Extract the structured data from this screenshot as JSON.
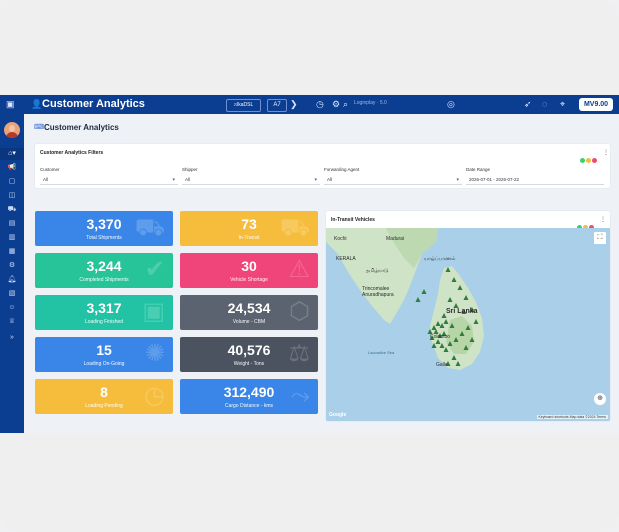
{
  "header": {
    "title": "Customer Analytics",
    "logo_text": "ෆlkaDSL",
    "language": "A7",
    "center_text": "Loginplay · 5.0",
    "right_button": "MV9.00"
  },
  "sidebar": {
    "icons": [
      "home-icon",
      "megaphone-icon",
      "box-icon",
      "package-icon",
      "truck-icon",
      "archive-icon",
      "building-icon",
      "document-icon",
      "gear-icon",
      "bell-icon",
      "calendar-icon",
      "user-icon",
      "trophy-icon",
      "expand-icon"
    ]
  },
  "page": {
    "title": "Customer Analytics"
  },
  "filters": {
    "title": "Customer Analytics Filters",
    "fields": [
      {
        "label": "Customer",
        "value": "All"
      },
      {
        "label": "Shipper",
        "value": "All"
      },
      {
        "label": "Forwarding Agent",
        "value": "All"
      },
      {
        "label": "Date Range",
        "value": "2026-07-01 - 2026-07-22"
      }
    ]
  },
  "tiles": [
    {
      "value": "3,370",
      "label": "Total Shipments",
      "color": "#3a86e8",
      "icon": "truck-icon"
    },
    {
      "value": "73",
      "label": "In-Transit",
      "color": "#f6bd3c",
      "icon": "truck-icon"
    },
    {
      "value": "3,244",
      "label": "Completed Shipments",
      "color": "#27c49a",
      "icon": "check-icon"
    },
    {
      "value": "30",
      "label": "Vehicle Shortage",
      "color": "#f0457a",
      "icon": "warning-icon"
    },
    {
      "value": "3,317",
      "label": "Loading Finished",
      "color": "#21c3a4",
      "icon": "box-icon"
    },
    {
      "value": "24,534",
      "label": "Volume - CBM",
      "color": "#5b6370",
      "icon": "cube-icon"
    },
    {
      "value": "15",
      "label": "Loading On-Going",
      "color": "#3a86e8",
      "icon": "spinner-icon"
    },
    {
      "value": "40,576",
      "label": "Weight - Tons",
      "color": "#4b5260",
      "icon": "weight-icon"
    },
    {
      "value": "8",
      "label": "Loading Pending",
      "color": "#f6bd3c",
      "icon": "clock-icon"
    },
    {
      "value": "312,490",
      "label": "Cargo Distance - kms",
      "color": "#3a86e8",
      "icon": "route-icon"
    }
  ],
  "map": {
    "title": "In-Transit Vehicles",
    "labels": {
      "kochi": "Kochi",
      "madurai": "Madurai",
      "kerala": "KERALA",
      "tamil": "தமிழ்நாடு",
      "jaffna": "யாழ்ப்பாணம்",
      "trinco": "Trincomalee",
      "anura": "Anuradhapura",
      "srilanka": "Sri Lanka",
      "colombo": "Colombo",
      "galle": "Galle",
      "laccadive": "Laccadive Sea"
    },
    "google": "Google",
    "attribution": "Keyboard shortcuts   Map data ©2024   Terms",
    "colors": {
      "land": "#cfe3c6",
      "sea": "#a9cfe9",
      "marker": "#2f7d3a"
    }
  },
  "colors": {
    "primary": "#0b3d91",
    "dot_green": "#3ccf6e",
    "dot_yellow": "#f6bd3c",
    "dot_red": "#ef4c6b"
  }
}
